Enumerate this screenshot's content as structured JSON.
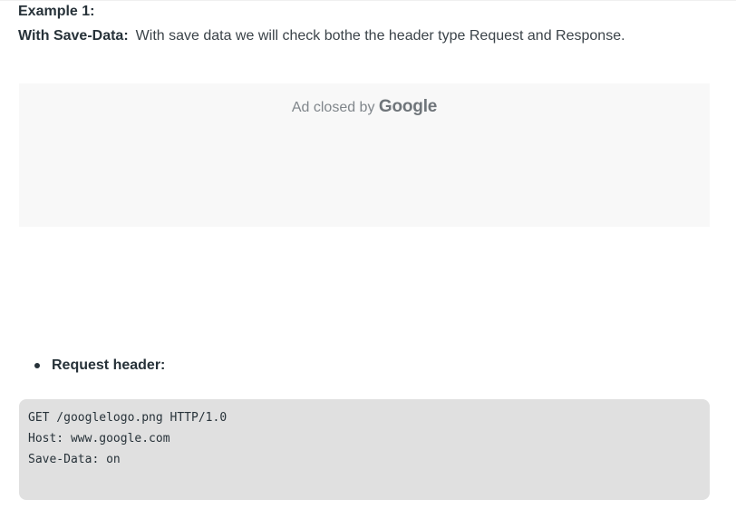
{
  "example": {
    "title": "Example 1:",
    "label": "With Save-Data:",
    "text": "With save data we will check bothe the header type Request and Response."
  },
  "ad": {
    "prefix": "Ad closed by ",
    "brand": "Google"
  },
  "request": {
    "bullet_label": "Request header:",
    "code_lines": [
      "GET /googlelogo.png HTTP/1.0",
      "Host: www.google.com",
      "Save-Data: on"
    ]
  },
  "colors": {
    "text": "#273239",
    "ad_background": "#f8f8f8",
    "code_background": "#e0e0e0"
  }
}
